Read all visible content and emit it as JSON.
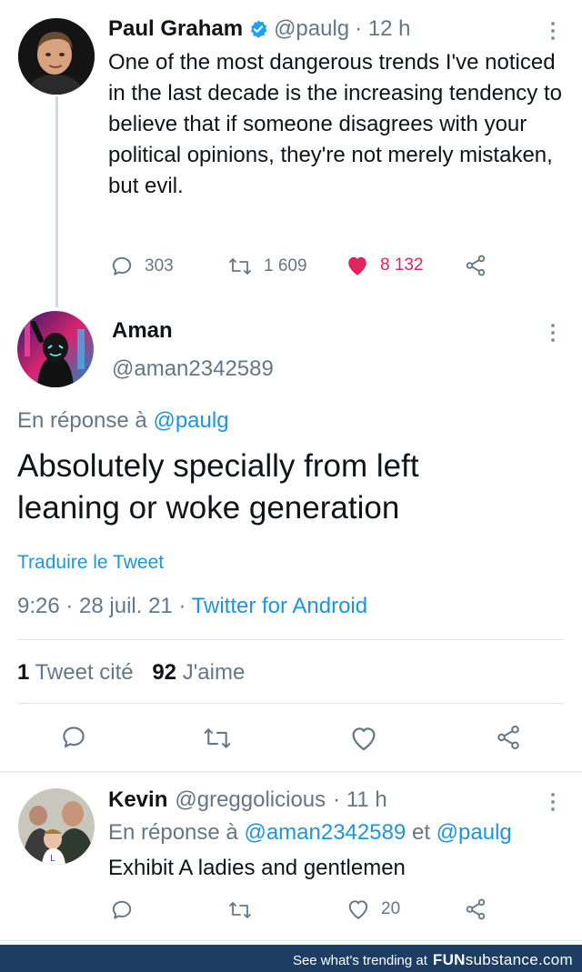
{
  "tweet1": {
    "name": "Paul Graham",
    "handle": "@paulg",
    "time": "· 12 h",
    "text": "One of the most dangerous trends I've noticed in the last decade is the increasing tendency to believe that if someone disagrees with your political opinions, they're not merely mistaken, but evil.",
    "replies": "303",
    "retweets": "1 609",
    "likes": "8 132"
  },
  "tweet2": {
    "name": "Aman",
    "handle": "@aman2342589",
    "reply_prefix": "En réponse à",
    "reply_to": "@paulg",
    "text": "Absolutely specially from left leaning or woke generation",
    "translate": "Traduire le Tweet",
    "timestamp": "9:26 · 28 juil. 21 ·",
    "source": "Twitter for Android",
    "quote_count": "1",
    "quote_label": "Tweet cité",
    "like_count": "92",
    "like_label": "J'aime"
  },
  "tweet3": {
    "name": "Kevin",
    "handle": "@greggolicious",
    "time": "· 11 h",
    "reply_prefix": "En réponse à",
    "reply_to_1": "@aman2342589",
    "reply_and": "et",
    "reply_to_2": "@paulg",
    "text": "Exhibit A ladies and gentlemen",
    "likes": "20"
  },
  "footer": {
    "text": "See what's trending at",
    "brand_a": "FUN",
    "brand_b": "substance",
    "brand_c": ".com"
  },
  "colors": {
    "like_red": "#e0245e",
    "link_blue": "#1b95e0",
    "muted": "#657786",
    "verified": "#1da1f2",
    "footer_bg": "#1d3d63"
  }
}
